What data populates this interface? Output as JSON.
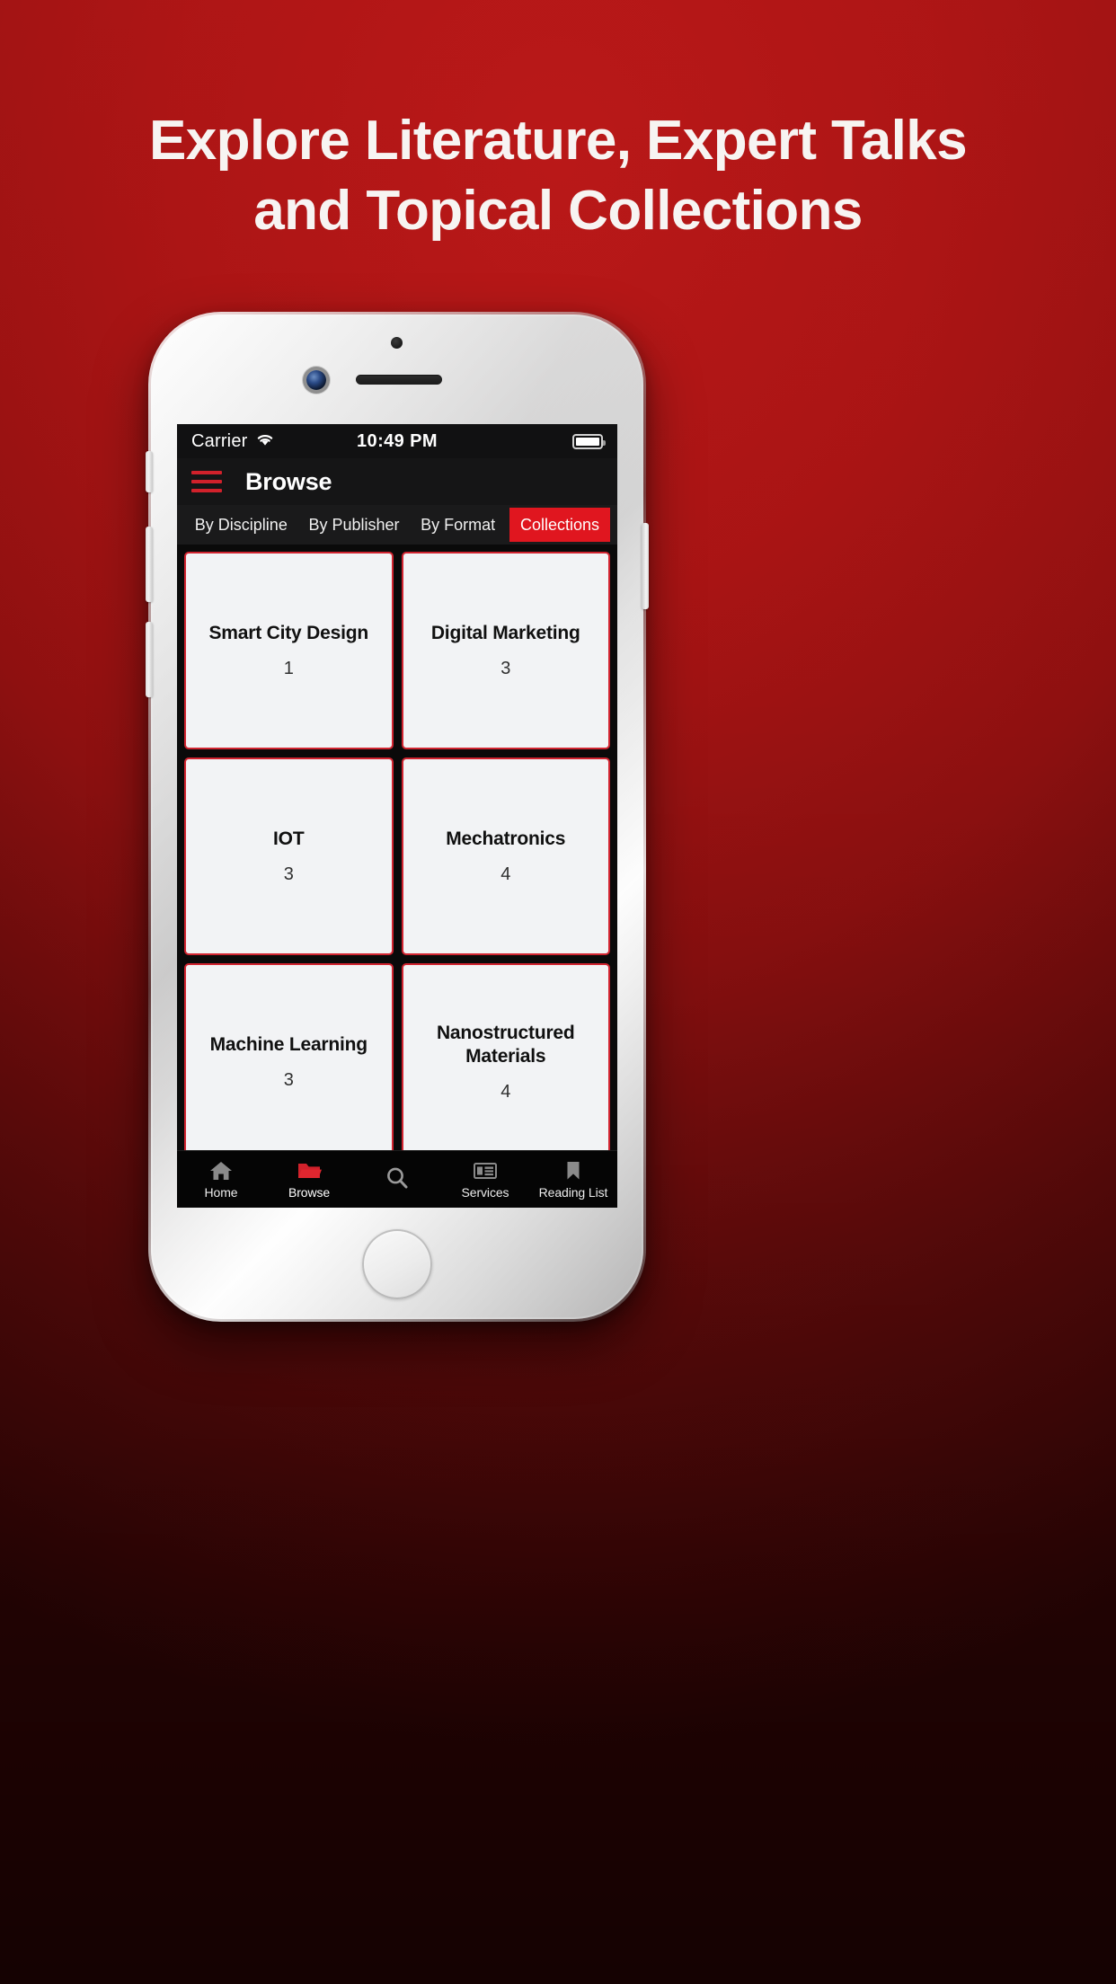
{
  "marketing": {
    "headline_line1": "Explore Literature, Expert Talks",
    "headline_line2": "and Topical Collections",
    "background_color": "#a81414",
    "accent_color": "#d12430"
  },
  "status_bar": {
    "carrier": "Carrier",
    "wifi_icon": "wifi-icon",
    "time": "10:49 PM",
    "battery_icon": "battery-full-icon"
  },
  "nav_bar": {
    "menu_icon": "hamburger-menu-icon",
    "title": "Browse"
  },
  "segmented_tabs": {
    "items": [
      {
        "label": "By Discipline",
        "active": false
      },
      {
        "label": "By Publisher",
        "active": false
      },
      {
        "label": "By Format",
        "active": false
      },
      {
        "label": "Collections",
        "active": true
      }
    ],
    "active_background": "#e0161f"
  },
  "collections": {
    "cards": [
      {
        "title": "Smart City Design",
        "count": "1"
      },
      {
        "title": "Digital Marketing",
        "count": "3"
      },
      {
        "title": "IOT",
        "count": "3"
      },
      {
        "title": "Mechatronics",
        "count": "4"
      },
      {
        "title": "Machine Learning",
        "count": "3"
      },
      {
        "title": "Nanostructured Materials",
        "count": "4"
      },
      {
        "title": "",
        "count": ""
      },
      {
        "title": "",
        "count": ""
      }
    ]
  },
  "bottom_tabs": {
    "items": [
      {
        "label": "Home",
        "icon": "home-icon",
        "active": false
      },
      {
        "label": "Browse",
        "icon": "folder-icon",
        "active": true
      },
      {
        "label": "",
        "icon": "search-icon",
        "active": false
      },
      {
        "label": "Services",
        "icon": "newspaper-icon",
        "active": false
      },
      {
        "label": "Reading List",
        "icon": "bookmark-icon",
        "active": false
      }
    ],
    "active_color": "#d1212b",
    "inactive_color": "#8a8a8a"
  }
}
